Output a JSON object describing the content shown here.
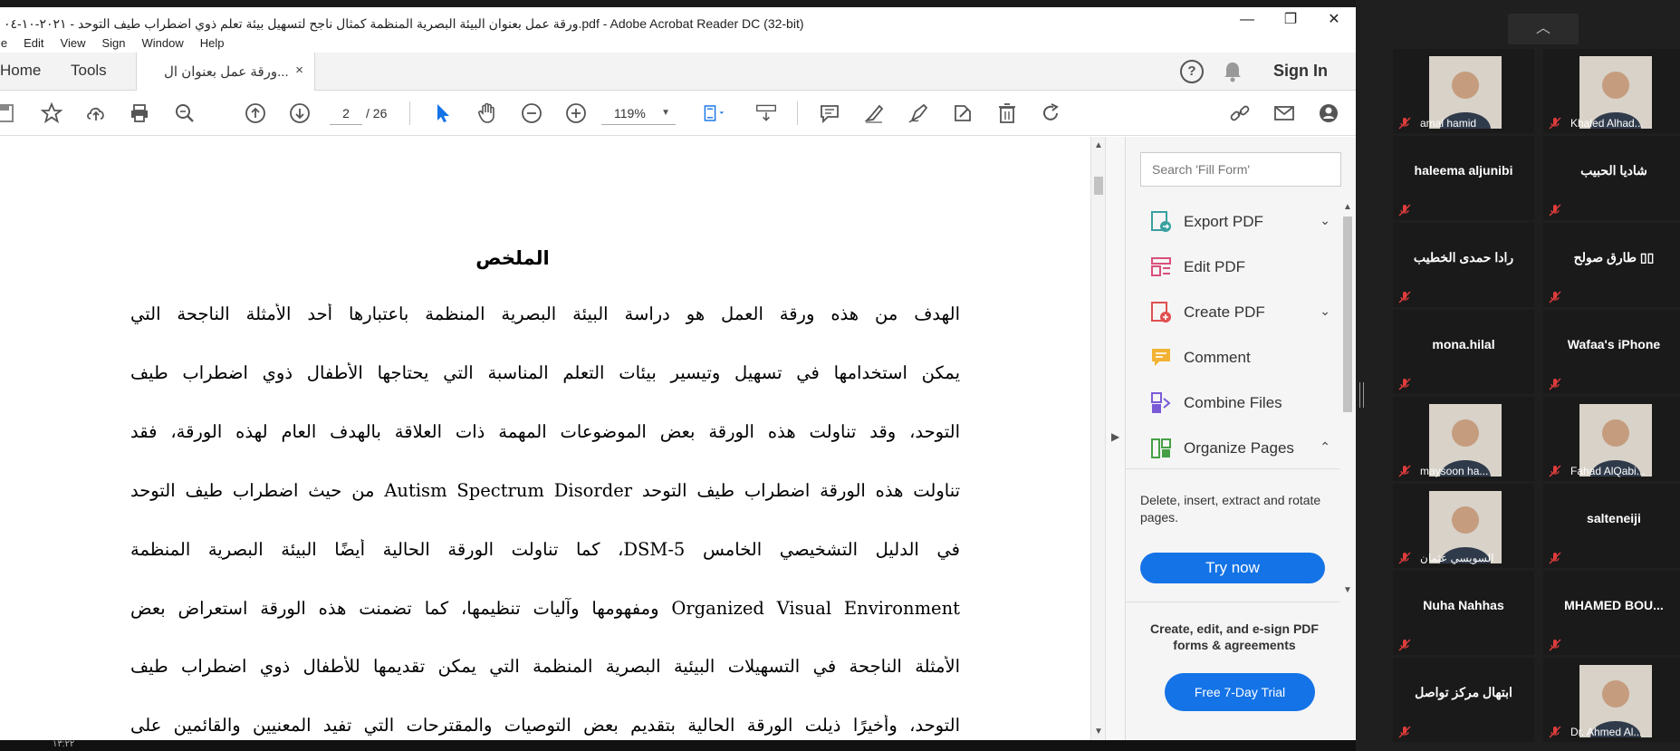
{
  "window": {
    "title": "ورقة عمل بعنوان البيئة البصرية المنظمة كمثال ناجح لتسهيل بيئة تعلم ذوي اضطراب طيف التوحد - ٢٠٢١-١٠-٠٤.pdf - Adobe Acrobat Reader DC (32-bit)",
    "minimize": "—",
    "restore": "❐",
    "close": "✕"
  },
  "menu": [
    "le",
    "Edit",
    "View",
    "Sign",
    "Window",
    "Help"
  ],
  "tabs": {
    "home": "Home",
    "tools": "Tools",
    "doc": "ورقة عمل بعنوان ال...",
    "close": "×",
    "help": "?",
    "sign_in": "Sign In"
  },
  "toolbar": {
    "page_current": "2",
    "page_total": "/  26",
    "zoom": "119%"
  },
  "document": {
    "heading": "الملخص",
    "lines": [
      "الهدف من هذه ورقة العمل هو دراسة البيئة البصرية المنظمة باعتبارها أحد الأمثلة الناجحة التي",
      "يمكن استخدامها في تسهيل وتيسير بيئات التعلم المناسبة التي يحتاجها الأطفال ذوي اضطراب طيف",
      "التوحد، وقد تناولت هذه الورقة بعض الموضوعات المهمة ذات العلاقة بالهدف العام لهذه الورقة، فقد",
      "تناولت هذه الورقة اضطراب طيف التوحد Autism Spectrum Disorder من حيث اضطراب طيف التوحد",
      "في الدليل التشخيصي الخامس DSM-5، كما تناولت الورقة الحالية أيضًا البيئة البصرية المنظمة",
      "Organized Visual Environment ومفهومها وآليات تنظيمها، كما تضمنت هذه الورقة استعراض بعض",
      "الأمثلة الناجحة في التسهيلات البيئية البصرية المنظمة التي يمكن تقديمها للأطفال ذوي اضطراب طيف",
      "التوحد، وأخيرًا ذيلت الورقة الحالية بتقديم بعض التوصيات والمقترحات التي تفيد المعنيين والقائمين على"
    ]
  },
  "tools_pane": {
    "search_placeholder": "Search 'Fill Form'",
    "items": [
      {
        "label": "Export PDF",
        "chevron": "⌄",
        "color": "#3aa0a0"
      },
      {
        "label": "Edit PDF",
        "chevron": "",
        "color": "#d94f7a"
      },
      {
        "label": "Create PDF",
        "chevron": "⌄",
        "color": "#e0504f"
      },
      {
        "label": "Comment",
        "chevron": "",
        "color": "#f2b233"
      },
      {
        "label": "Combine Files",
        "chevron": "",
        "color": "#7a5bd6"
      },
      {
        "label": "Organize Pages",
        "chevron": "⌃",
        "color": "#45a045"
      }
    ],
    "description": "Delete, insert, extract and rotate pages.",
    "try_now": "Try now",
    "promo": "Create, edit, and e-sign PDF forms & agreements",
    "free_trial": "Free 7-Day Trial"
  },
  "taskbar": {
    "text": "١٣:٢٢"
  },
  "gallery": {
    "up_arrow": "︿",
    "participants": [
      {
        "name": "amal hamid",
        "video": true
      },
      {
        "name": "Khaled Alhad...",
        "video": true
      },
      {
        "name": "haleema aljunibi",
        "video": false
      },
      {
        "name": "شاديا الحبيب",
        "video": false
      },
      {
        "name": "رادا حمدى  الخطيب",
        "video": false
      },
      {
        "name": "طارق صولح  ▯▯",
        "video": false
      },
      {
        "name": "mona.hilal",
        "video": false
      },
      {
        "name": "Wafaa's iPhone",
        "video": false
      },
      {
        "name": "maysoon ha...",
        "video": true
      },
      {
        "name": "Fahad AlQabi...",
        "video": true
      },
      {
        "name": "السويسي عثمان",
        "video": true
      },
      {
        "name": "salteneiji",
        "video": false
      },
      {
        "name": "Nuha Nahhas",
        "video": false
      },
      {
        "name": "MHAMED  BOU...",
        "video": false
      },
      {
        "name": "ابتهال مركز تواصل",
        "video": false
      },
      {
        "name": "Dr. Ahmed Al...",
        "video": true
      }
    ]
  },
  "colors": {
    "accent": "#1473e6",
    "mic_muted": "#e03c3c"
  }
}
